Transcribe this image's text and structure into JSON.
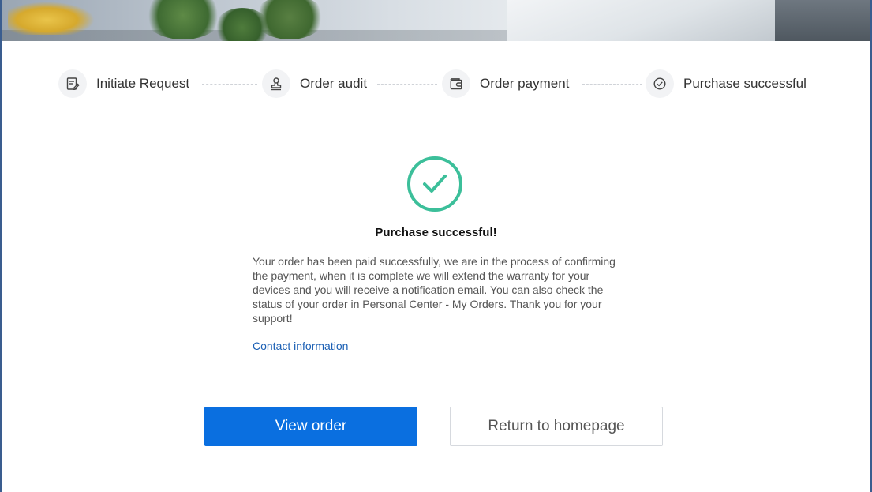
{
  "steps": [
    {
      "label": "Initiate Request",
      "icon": "document-edit-icon"
    },
    {
      "label": "Order audit",
      "icon": "stamp-icon"
    },
    {
      "label": "Order payment",
      "icon": "wallet-icon"
    },
    {
      "label": "Purchase successful",
      "icon": "check-circle-icon"
    }
  ],
  "result": {
    "icon": "success-check-icon",
    "icon_color": "#3cbf9a",
    "title": "Purchase successful!",
    "message": "Your order has been paid successfully, we are in the process of confirming the payment, when it is complete we will extend the warranty for your devices and you will receive a notification email. You can also check the status of your order in Personal Center - My Orders. Thank you for your support!",
    "contact_link": "Contact information"
  },
  "actions": {
    "view_order": "View order",
    "return_home": "Return to homepage"
  },
  "colors": {
    "primary": "#0a6fe0",
    "link": "#1a5fb4",
    "success": "#3cbf9a"
  }
}
